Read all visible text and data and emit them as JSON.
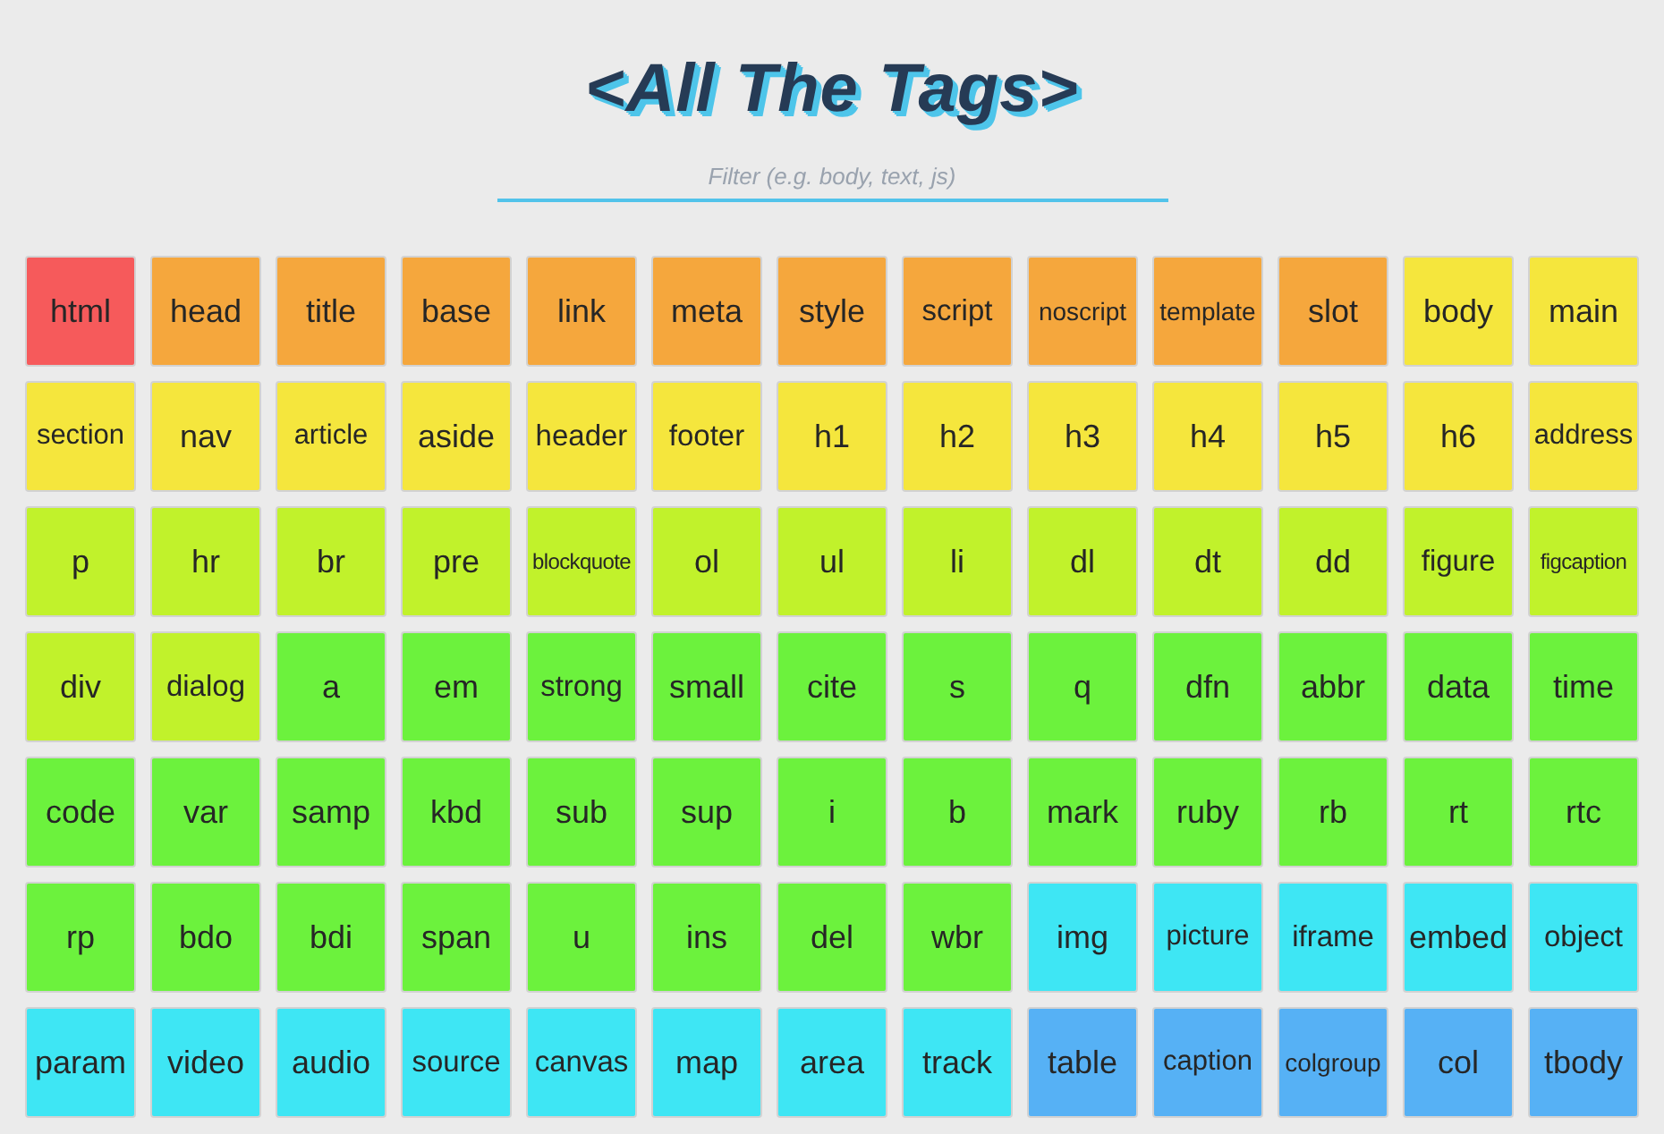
{
  "title": "<All The Tags>",
  "filter": {
    "placeholder": "Filter (e.g. body, text, js)"
  },
  "tags": [
    {
      "label": "html",
      "color": "#f65a5b"
    },
    {
      "label": "head",
      "color": "#f5a73d"
    },
    {
      "label": "title",
      "color": "#f5a73d"
    },
    {
      "label": "base",
      "color": "#f5a73d"
    },
    {
      "label": "link",
      "color": "#f5a73d"
    },
    {
      "label": "meta",
      "color": "#f5a73d"
    },
    {
      "label": "style",
      "color": "#f5a73d"
    },
    {
      "label": "script",
      "color": "#f5a73d"
    },
    {
      "label": "noscript",
      "color": "#f5a73d"
    },
    {
      "label": "template",
      "color": "#f5a73d"
    },
    {
      "label": "slot",
      "color": "#f5a73d"
    },
    {
      "label": "body",
      "color": "#f5e63d"
    },
    {
      "label": "main",
      "color": "#f5e63d"
    },
    {
      "label": "section",
      "color": "#f5e63d"
    },
    {
      "label": "nav",
      "color": "#f5e63d"
    },
    {
      "label": "article",
      "color": "#f5e63d"
    },
    {
      "label": "aside",
      "color": "#f5e63d"
    },
    {
      "label": "header",
      "color": "#f5e63d"
    },
    {
      "label": "footer",
      "color": "#f5e63d"
    },
    {
      "label": "h1",
      "color": "#f5e63d"
    },
    {
      "label": "h2",
      "color": "#f5e63d"
    },
    {
      "label": "h3",
      "color": "#f5e63d"
    },
    {
      "label": "h4",
      "color": "#f5e63d"
    },
    {
      "label": "h5",
      "color": "#f5e63d"
    },
    {
      "label": "h6",
      "color": "#f5e63d"
    },
    {
      "label": "address",
      "color": "#f5e63d"
    },
    {
      "label": "p",
      "color": "#c1f22b"
    },
    {
      "label": "hr",
      "color": "#c1f22b"
    },
    {
      "label": "br",
      "color": "#c1f22b"
    },
    {
      "label": "pre",
      "color": "#c1f22b"
    },
    {
      "label": "blockquote",
      "color": "#c1f22b"
    },
    {
      "label": "ol",
      "color": "#c1f22b"
    },
    {
      "label": "ul",
      "color": "#c1f22b"
    },
    {
      "label": "li",
      "color": "#c1f22b"
    },
    {
      "label": "dl",
      "color": "#c1f22b"
    },
    {
      "label": "dt",
      "color": "#c1f22b"
    },
    {
      "label": "dd",
      "color": "#c1f22b"
    },
    {
      "label": "figure",
      "color": "#c1f22b"
    },
    {
      "label": "figcaption",
      "color": "#c1f22b"
    },
    {
      "label": "div",
      "color": "#c1f22b"
    },
    {
      "label": "dialog",
      "color": "#c1f22b"
    },
    {
      "label": "a",
      "color": "#6cf23d"
    },
    {
      "label": "em",
      "color": "#6cf23d"
    },
    {
      "label": "strong",
      "color": "#6cf23d"
    },
    {
      "label": "small",
      "color": "#6cf23d"
    },
    {
      "label": "cite",
      "color": "#6cf23d"
    },
    {
      "label": "s",
      "color": "#6cf23d"
    },
    {
      "label": "q",
      "color": "#6cf23d"
    },
    {
      "label": "dfn",
      "color": "#6cf23d"
    },
    {
      "label": "abbr",
      "color": "#6cf23d"
    },
    {
      "label": "data",
      "color": "#6cf23d"
    },
    {
      "label": "time",
      "color": "#6cf23d"
    },
    {
      "label": "code",
      "color": "#6cf23d"
    },
    {
      "label": "var",
      "color": "#6cf23d"
    },
    {
      "label": "samp",
      "color": "#6cf23d"
    },
    {
      "label": "kbd",
      "color": "#6cf23d"
    },
    {
      "label": "sub",
      "color": "#6cf23d"
    },
    {
      "label": "sup",
      "color": "#6cf23d"
    },
    {
      "label": "i",
      "color": "#6cf23d"
    },
    {
      "label": "b",
      "color": "#6cf23d"
    },
    {
      "label": "mark",
      "color": "#6cf23d"
    },
    {
      "label": "ruby",
      "color": "#6cf23d"
    },
    {
      "label": "rb",
      "color": "#6cf23d"
    },
    {
      "label": "rt",
      "color": "#6cf23d"
    },
    {
      "label": "rtc",
      "color": "#6cf23d"
    },
    {
      "label": "rp",
      "color": "#6cf23d"
    },
    {
      "label": "bdo",
      "color": "#6cf23d"
    },
    {
      "label": "bdi",
      "color": "#6cf23d"
    },
    {
      "label": "span",
      "color": "#6cf23d"
    },
    {
      "label": "u",
      "color": "#6cf23d"
    },
    {
      "label": "ins",
      "color": "#6cf23d"
    },
    {
      "label": "del",
      "color": "#6cf23d"
    },
    {
      "label": "wbr",
      "color": "#6cf23d"
    },
    {
      "label": "img",
      "color": "#3ee6f4"
    },
    {
      "label": "picture",
      "color": "#3ee6f4"
    },
    {
      "label": "iframe",
      "color": "#3ee6f4"
    },
    {
      "label": "embed",
      "color": "#3ee6f4"
    },
    {
      "label": "object",
      "color": "#3ee6f4"
    },
    {
      "label": "param",
      "color": "#3ee6f4"
    },
    {
      "label": "video",
      "color": "#3ee6f4"
    },
    {
      "label": "audio",
      "color": "#3ee6f4"
    },
    {
      "label": "source",
      "color": "#3ee6f4"
    },
    {
      "label": "canvas",
      "color": "#3ee6f4"
    },
    {
      "label": "map",
      "color": "#3ee6f4"
    },
    {
      "label": "area",
      "color": "#3ee6f4"
    },
    {
      "label": "track",
      "color": "#3ee6f4"
    },
    {
      "label": "table",
      "color": "#56b1f5"
    },
    {
      "label": "caption",
      "color": "#56b1f5"
    },
    {
      "label": "colgroup",
      "color": "#56b1f5"
    },
    {
      "label": "col",
      "color": "#56b1f5"
    },
    {
      "label": "tbody",
      "color": "#56b1f5"
    }
  ]
}
